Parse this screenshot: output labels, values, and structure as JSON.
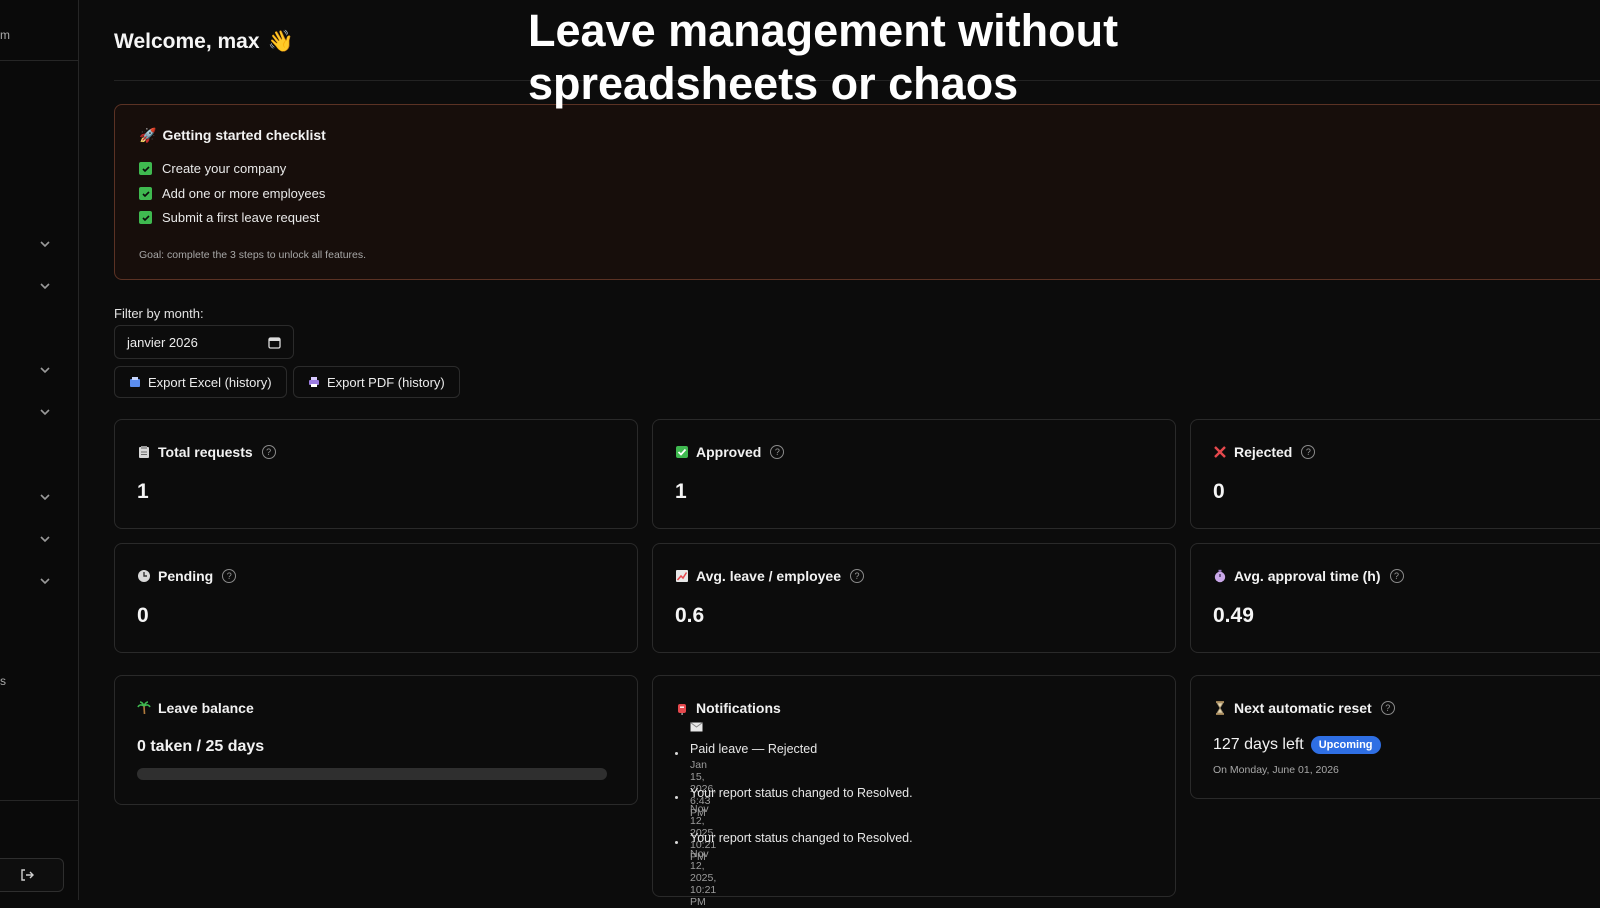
{
  "sidebar": {
    "brand_fragment": "m",
    "mark": "s",
    "logout_icon": "logout-icon"
  },
  "header": {
    "welcome": "Welcome, max",
    "wave_emoji": "👋"
  },
  "headline": "Leave management without spreadsheets or chaos",
  "checklist": {
    "title": "Getting started checklist",
    "items": [
      {
        "label": "Create your company",
        "done": true
      },
      {
        "label": "Add one or more employees",
        "done": true
      },
      {
        "label": "Submit a first leave request",
        "done": true
      }
    ],
    "goal": "Goal: complete the 3 steps to unlock all features."
  },
  "filter": {
    "label": "Filter by month:",
    "value": "janvier 2026"
  },
  "exports": {
    "excel_label": "Export Excel (history)",
    "pdf_label": "Export PDF (history)"
  },
  "stats": {
    "total": {
      "label": "Total requests",
      "value": "1"
    },
    "approved": {
      "label": "Approved",
      "value": "1"
    },
    "rejected": {
      "label": "Rejected",
      "value": "0"
    },
    "pending": {
      "label": "Pending",
      "value": "0"
    },
    "avg_leave": {
      "label": "Avg. leave / employee",
      "value": "0.6"
    },
    "avg_approval": {
      "label": "Avg. approval time (h)",
      "value": "0.49"
    }
  },
  "leave_balance": {
    "title": "Leave balance",
    "text": "0 taken / 25 days",
    "progress_fraction": 0
  },
  "notifications": {
    "title": "Notifications",
    "items": [
      {
        "text": "Paid leave — Rejected",
        "date": "Jan 15, 2026, 6:43 PM"
      },
      {
        "text": "Your report status changed to Resolved.",
        "date": "Nov 12, 2025, 10:21 PM"
      },
      {
        "text": "Your report status changed to Resolved.",
        "date": "Nov 12, 2025, 10:21 PM"
      }
    ]
  },
  "reset": {
    "title": "Next automatic reset",
    "days_left": "127 days left",
    "badge": "Upcoming",
    "date": "On Monday, June 01, 2026"
  },
  "colors": {
    "accent_blue": "#2f6fe4",
    "check_green": "#3fb950",
    "checklist_border": "#5b3224",
    "reject_red": "#e5484d"
  }
}
